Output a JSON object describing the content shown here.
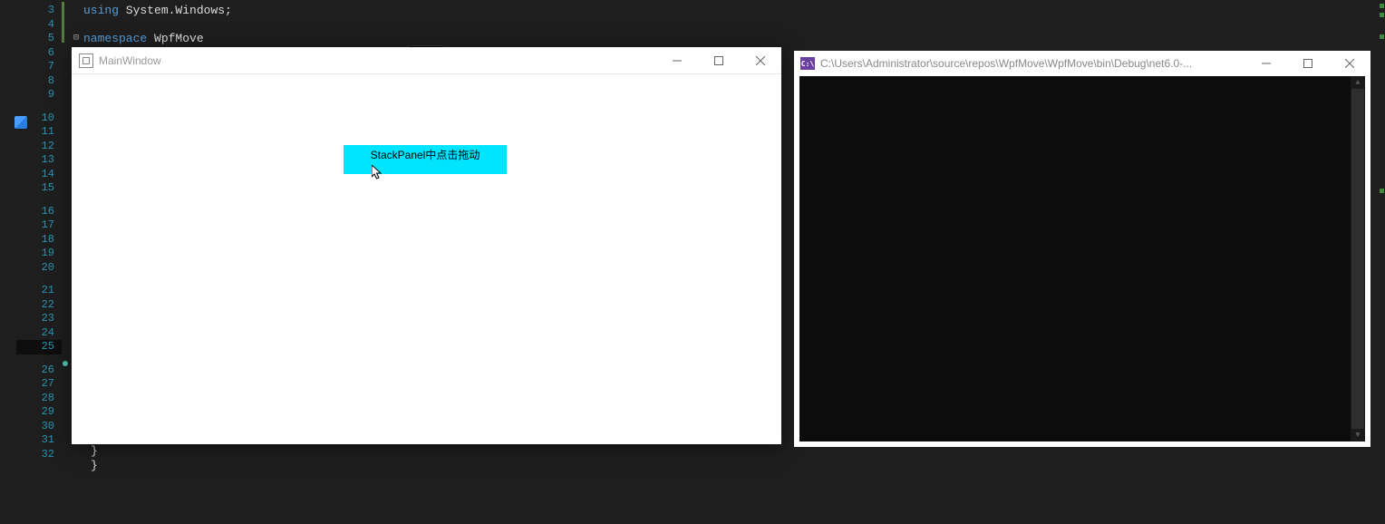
{
  "editor": {
    "line_numbers": [
      "3",
      "4",
      "5",
      "6",
      "7",
      "8",
      "9",
      "10",
      "11",
      "12",
      "13",
      "14",
      "15",
      "16",
      "17",
      "18",
      "19",
      "20",
      "21",
      "22",
      "23",
      "24",
      "25",
      "26",
      "27",
      "28",
      "29",
      "30",
      "31",
      "32"
    ],
    "current_line": "25",
    "code": {
      "l3_kw": "using",
      "l3_ns": "System.Windows;",
      "l5_kw": "namespace",
      "l5_ns": "WpfMove",
      "l30_brace": "}",
      "l31_brace": "}"
    }
  },
  "main_window": {
    "title": "MainWindow",
    "panel_text": "StackPanel中点击拖动"
  },
  "console_window": {
    "icon_text": "C:\\",
    "title": "C:\\Users\\Administrator\\source\\repos\\WpfMove\\WpfMove\\bin\\Debug\\net6.0-..."
  }
}
